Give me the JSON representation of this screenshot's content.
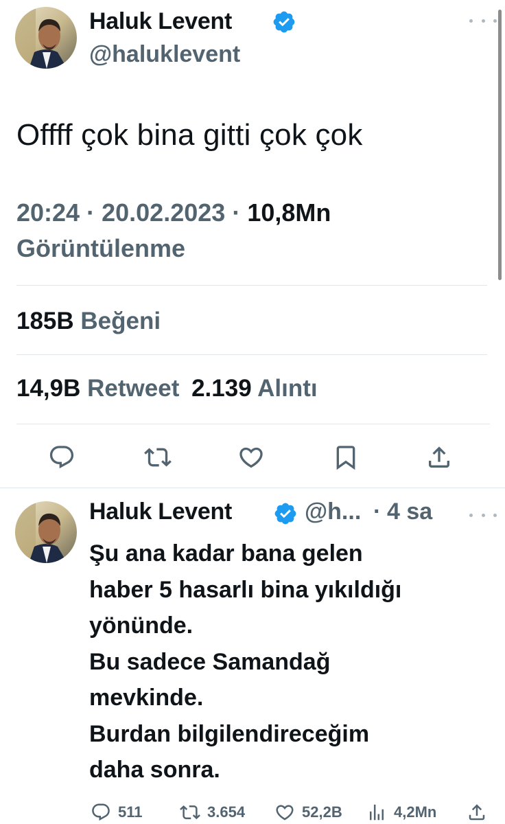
{
  "main_tweet": {
    "author_name": "Haluk Levent",
    "author_handle": "@haluklevent",
    "text": "Offff çok bina gitti çok çok",
    "time": "20:24",
    "separator": "·",
    "date": "20.02.2023",
    "views_count": "10,8Mn",
    "views_label": "Görüntülenme",
    "likes_count": "185B",
    "likes_label": "Beğeni",
    "retweets_count": "14,9B",
    "retweets_label": "Retweet",
    "quotes_count": "2.139",
    "quotes_label": "Alıntı",
    "icons": [
      "reply-icon",
      "retweet-icon",
      "like-icon",
      "bookmark-icon",
      "share-icon"
    ]
  },
  "reply_tweet": {
    "author_name": "Haluk Levent",
    "author_handle": "@h...",
    "separator": "·",
    "time_ago": "4 sa",
    "lines": [
      "Şu ana kadar bana gelen",
      "haber 5 hasarlı bina yıkıldığı",
      "yönünde.",
      "Bu sadece Samandağ",
      "mevkinde.",
      "Burdan bilgilendireceğim",
      "daha sonra."
    ],
    "replies": "511",
    "retweets": "3.654",
    "likes": "52,2B",
    "views": "4,2Mn"
  },
  "colors": {
    "text_primary": "#0f1419",
    "text_secondary": "#536471",
    "verified_blue": "#1d9bf0",
    "divider": "#e1e6ea"
  }
}
